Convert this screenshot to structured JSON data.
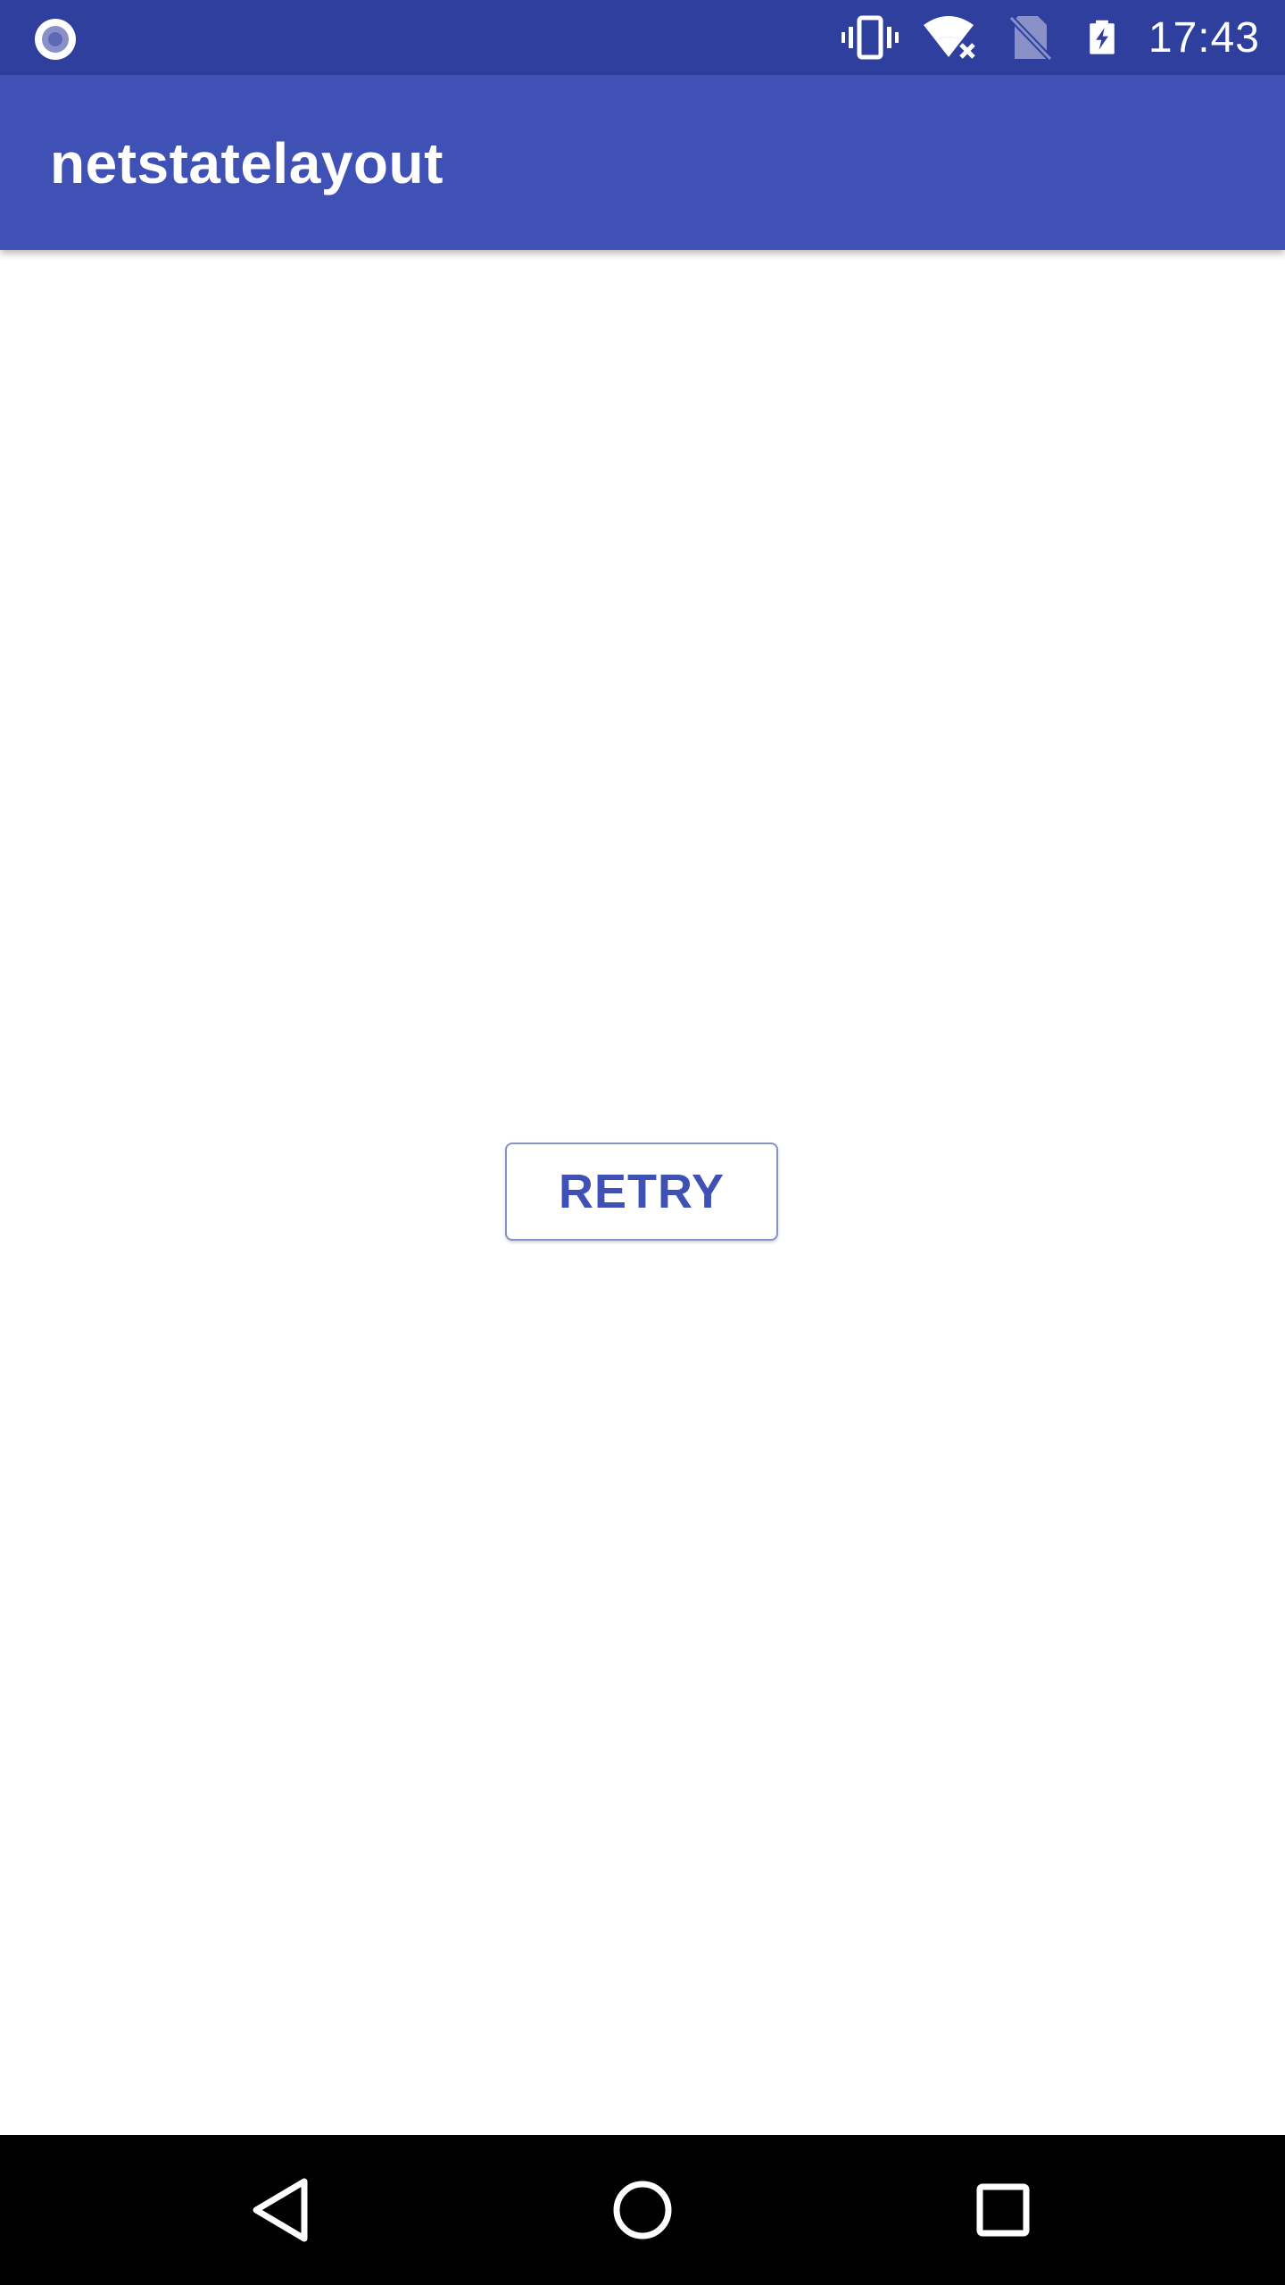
{
  "status_bar": {
    "time": "17:43",
    "icons": [
      "notification-dot-icon",
      "vibrate-icon",
      "wifi-no-internet-icon",
      "no-sim-icon",
      "battery-charging-icon"
    ],
    "background_color": "#2f3f9e"
  },
  "app_bar": {
    "title": "netstatelayout",
    "background_color": "#3f51b5"
  },
  "content": {
    "retry_button_label": "RETRY",
    "accent_color": "#3f51b5"
  },
  "nav_bar": {
    "buttons": [
      "back-icon",
      "home-icon",
      "recents-icon"
    ]
  }
}
